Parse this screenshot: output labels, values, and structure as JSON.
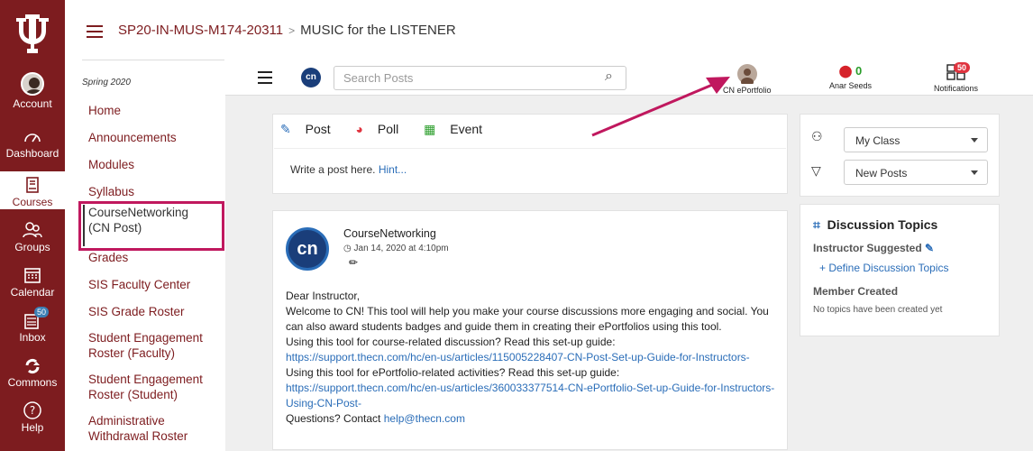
{
  "global_nav": {
    "items": [
      {
        "label": "Account"
      },
      {
        "label": "Dashboard"
      },
      {
        "label": "Courses"
      },
      {
        "label": "Groups"
      },
      {
        "label": "Calendar"
      },
      {
        "label": "Inbox",
        "badge": "50"
      },
      {
        "label": "Commons"
      },
      {
        "label": "Help"
      }
    ],
    "brand_color": "#7d1c1f"
  },
  "breadcrumb": {
    "course": "SP20-IN-MUS-M174-20311",
    "page": "MUSIC for the LISTENER"
  },
  "course_nav": {
    "term": "Spring 2020",
    "items": [
      "Home",
      "Announcements",
      "Modules",
      "Syllabus",
      "CourseNetworking (CN Post)",
      "Grades",
      "SIS Faculty Center",
      "SIS Grade Roster",
      "Student Engagement Roster (Faculty)",
      "Student Engagement Roster (Student)",
      "Administrative Withdrawal Roster"
    ]
  },
  "topbar": {
    "logo": "cn",
    "search_placeholder": "Search Posts",
    "eportfolio_label": "CN ePortfolio",
    "anar_count": "0",
    "anar_label": "Anar Seeds",
    "notif_badge": "50",
    "notif_label": "Notifications"
  },
  "composer": {
    "tabs": [
      "Post",
      "Poll",
      "Event"
    ],
    "prompt": "Write a post here.",
    "hint": "Hint..."
  },
  "post": {
    "author": "CourseNetworking",
    "date": "Jan 14, 2020 at 4:10pm",
    "avatar_text": "cn",
    "l1": "Dear Instructor,",
    "l2": "Welcome to CN! This tool will help you make your course discussions more engaging and social. You can also award students badges and guide them in creating their ePortfolios using this tool.",
    "l3": "Using this tool for course-related discussion? Read this set-up guide:",
    "link1": "https://support.thecn.com/hc/en-us/articles/115005228407-CN-Post-Set-up-Guide-for-Instructors-",
    "l4": "Using this tool for ePortfolio-related activities? Read this set-up guide:",
    "link2": "https://support.thecn.com/hc/en-us/articles/360033377514-CN-ePortfolio-Set-up-Guide-for-Instructors-Using-CN-Post-",
    "l5": "Questions? Contact ",
    "email": "help@thecn.com"
  },
  "filters": {
    "class": "My Class",
    "sort": "New Posts"
  },
  "discussion": {
    "title": "Discussion Topics",
    "instructor_label": "Instructor Suggested",
    "define_link": "+ Define Discussion Topics",
    "member_label": "Member Created",
    "empty": "No topics have been created yet"
  },
  "colors": {
    "highlight_box": "#c0185e",
    "arrow": "#c0185e",
    "link": "#2a6db8"
  }
}
